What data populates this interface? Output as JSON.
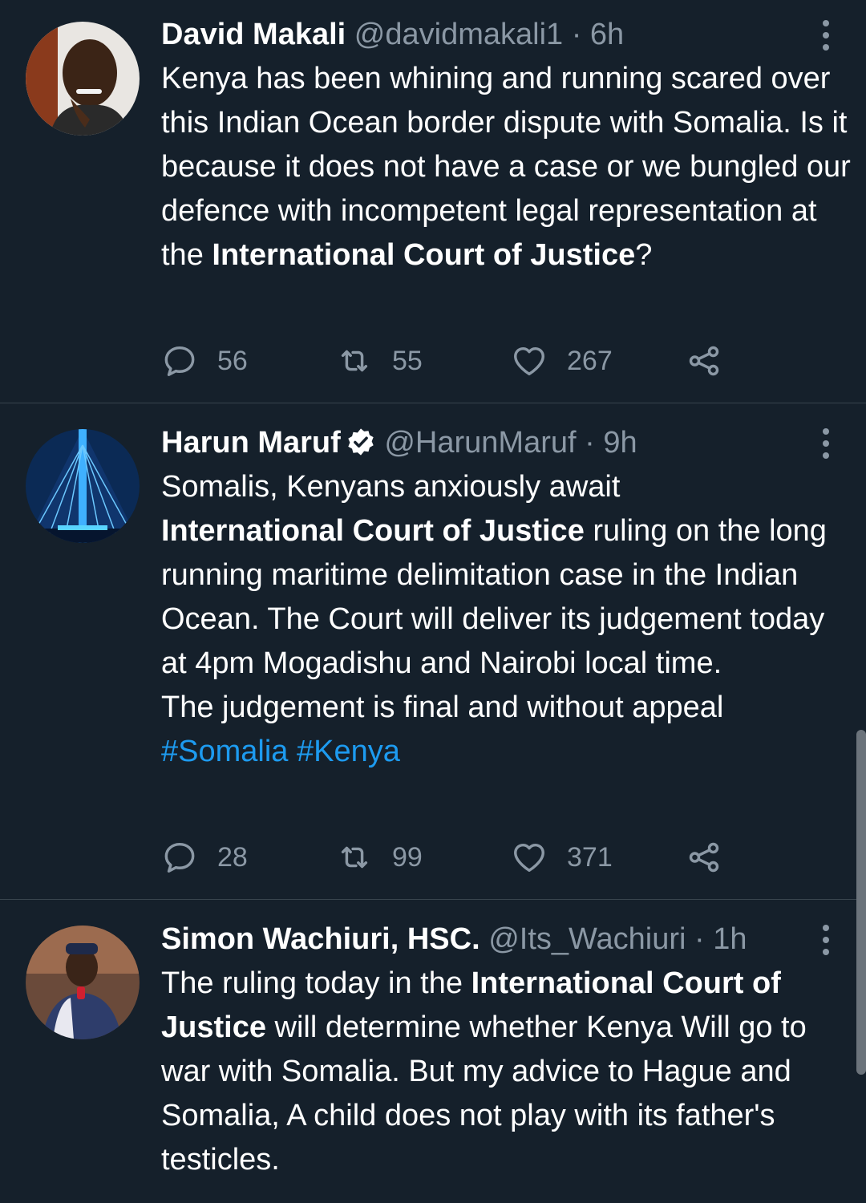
{
  "tweets": [
    {
      "name": "David Makali",
      "handle": "@davidmakali1",
      "sep": " · ",
      "time": "6h",
      "verified": false,
      "text": [
        {
          "t": "Kenya has been whining and running scared over this Indian Ocean border dispute with Somalia. Is it because it does not have a case or we bungled our defence with incompetent legal representation at the "
        },
        {
          "t": "International Court of Justice",
          "b": true
        },
        {
          "t": "?"
        }
      ],
      "replies": "56",
      "retweets": "55",
      "likes": "267"
    },
    {
      "name": "Harun Maruf",
      "handle": "@HarunMaruf",
      "sep": " · ",
      "time": "9h",
      "verified": true,
      "text": [
        {
          "t": "Somalis, Kenyans anxiously await\n"
        },
        {
          "t": "International Court of Justice",
          "b": true
        },
        {
          "t": " ruling on the long running maritime delimitation case in the Indian Ocean. The Court will deliver its judgement today at 4pm Mogadishu and Nairobi local time.\nThe judgement is final and without appeal\n"
        },
        {
          "t": "#Somalia",
          "tag": true
        },
        {
          "t": " "
        },
        {
          "t": "#Kenya",
          "tag": true
        }
      ],
      "replies": "28",
      "retweets": "99",
      "likes": "371"
    },
    {
      "name": "Simon Wachiuri, HSC.",
      "handle": "@Its_Wachiuri",
      "sep": " · ",
      "time": "1h",
      "verified": false,
      "text": [
        {
          "t": "The ruling today in the "
        },
        {
          "t": "International Court of Justice",
          "b": true
        },
        {
          "t": " will determine whether Kenya Will go to war with Somalia. But my advice to Hague and Somalia, A child does not play with its father's testicles."
        }
      ],
      "replies": "",
      "retweets": "",
      "likes": ""
    }
  ],
  "icons": {
    "reply": "reply-icon",
    "retweet": "retweet-icon",
    "like": "heart-icon",
    "share": "share-icon",
    "more": "more-vertical-icon",
    "verified": "verified-badge-icon"
  },
  "colors": {
    "background": "#15202b",
    "divider": "#38444d",
    "muted": "#8b98a5",
    "link": "#1d9bf0"
  }
}
